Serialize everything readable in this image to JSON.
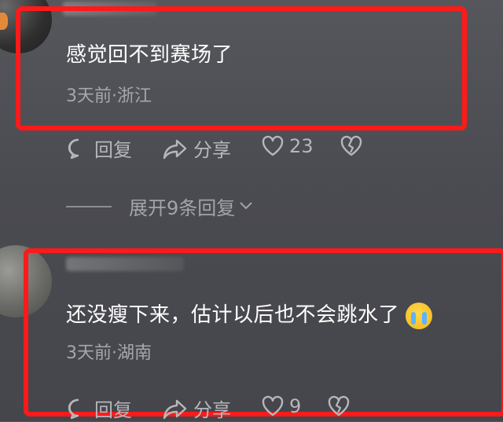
{
  "comments": [
    {
      "text": "感觉回不到赛场了",
      "meta": "3天前·浙江",
      "reply_label": "回复",
      "share_label": "分享",
      "like_count": "23"
    },
    {
      "text": "还没瘦下来，估计以后也不会跳水了",
      "emoji": "crying-face",
      "meta": "3天前·湖南",
      "reply_label": "回复",
      "share_label": "分享",
      "like_count": "9"
    }
  ],
  "expand_replies": "展开9条回复",
  "colors": {
    "highlight": "#ff1a1a",
    "background": "#4d4e53",
    "meta_text": "#a6a7ab"
  }
}
